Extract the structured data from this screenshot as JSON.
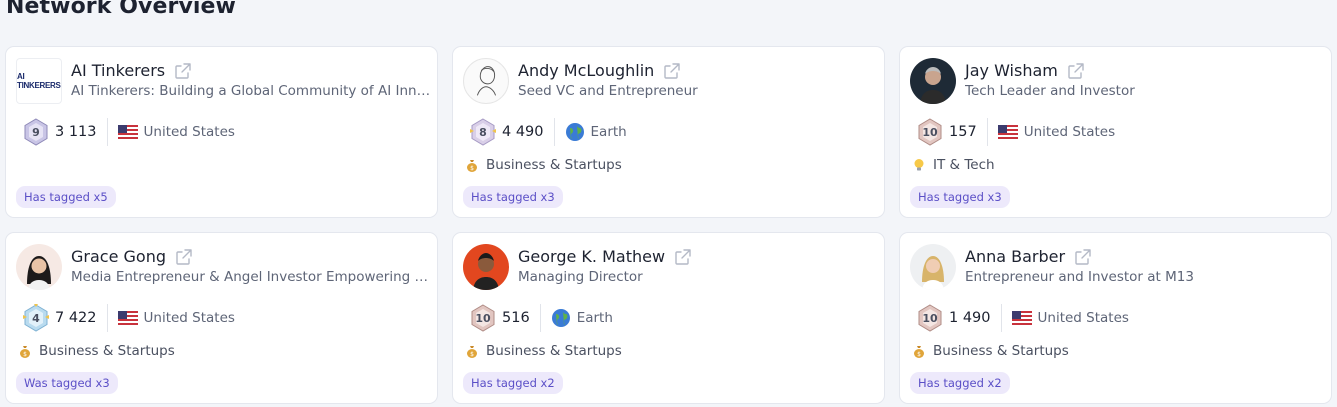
{
  "page": {
    "title": "Network Overview"
  },
  "colors": {
    "tag_bg": "#ede9fb",
    "tag_text": "#5b4fc7",
    "card_bg": "#ffffff",
    "page_bg": "#f3f5f9"
  },
  "cards": [
    {
      "name": "AI Tinkerers",
      "subtitle": "AI Tinkerers: Building a Global Community of AI Innovators",
      "avatar_text": "AI TINKERERS",
      "level": "9",
      "score": "3 113",
      "location": "United States",
      "location_icon": "us-flag-icon",
      "category": "",
      "tag": "Has tagged x5"
    },
    {
      "name": "Andy McLoughlin",
      "subtitle": "Seed VC and Entrepreneur",
      "level": "8",
      "score": "4 490",
      "location": "Earth",
      "location_icon": "earth-globe-icon",
      "category": "Business & Startups",
      "category_icon": "money-bag-icon",
      "tag": "Has tagged x3"
    },
    {
      "name": "Jay Wisham",
      "subtitle": "Tech Leader and Investor",
      "level": "10",
      "score": "157",
      "location": "United States",
      "location_icon": "us-flag-icon",
      "category": "IT & Tech",
      "category_icon": "lightbulb-icon",
      "tag": "Has tagged x3"
    },
    {
      "name": "Grace Gong",
      "subtitle": "Media Entrepreneur & Angel Investor Empowering Tech Founders",
      "level": "4",
      "score": "7 422",
      "location": "United States",
      "location_icon": "us-flag-icon",
      "category": "Business & Startups",
      "category_icon": "money-bag-icon",
      "tag": "Was tagged x3"
    },
    {
      "name": "George K. Mathew",
      "subtitle": "Managing Director",
      "level": "10",
      "score": "516",
      "location": "Earth",
      "location_icon": "earth-globe-icon",
      "category": "Business & Startups",
      "category_icon": "money-bag-icon",
      "tag": "Has tagged x2"
    },
    {
      "name": "Anna Barber",
      "subtitle": "Entrepreneur and Investor at M13",
      "level": "10",
      "score": "1 490",
      "location": "United States",
      "location_icon": "us-flag-icon",
      "category": "Business & Startups",
      "category_icon": "money-bag-icon",
      "tag": "Has tagged x2"
    }
  ]
}
